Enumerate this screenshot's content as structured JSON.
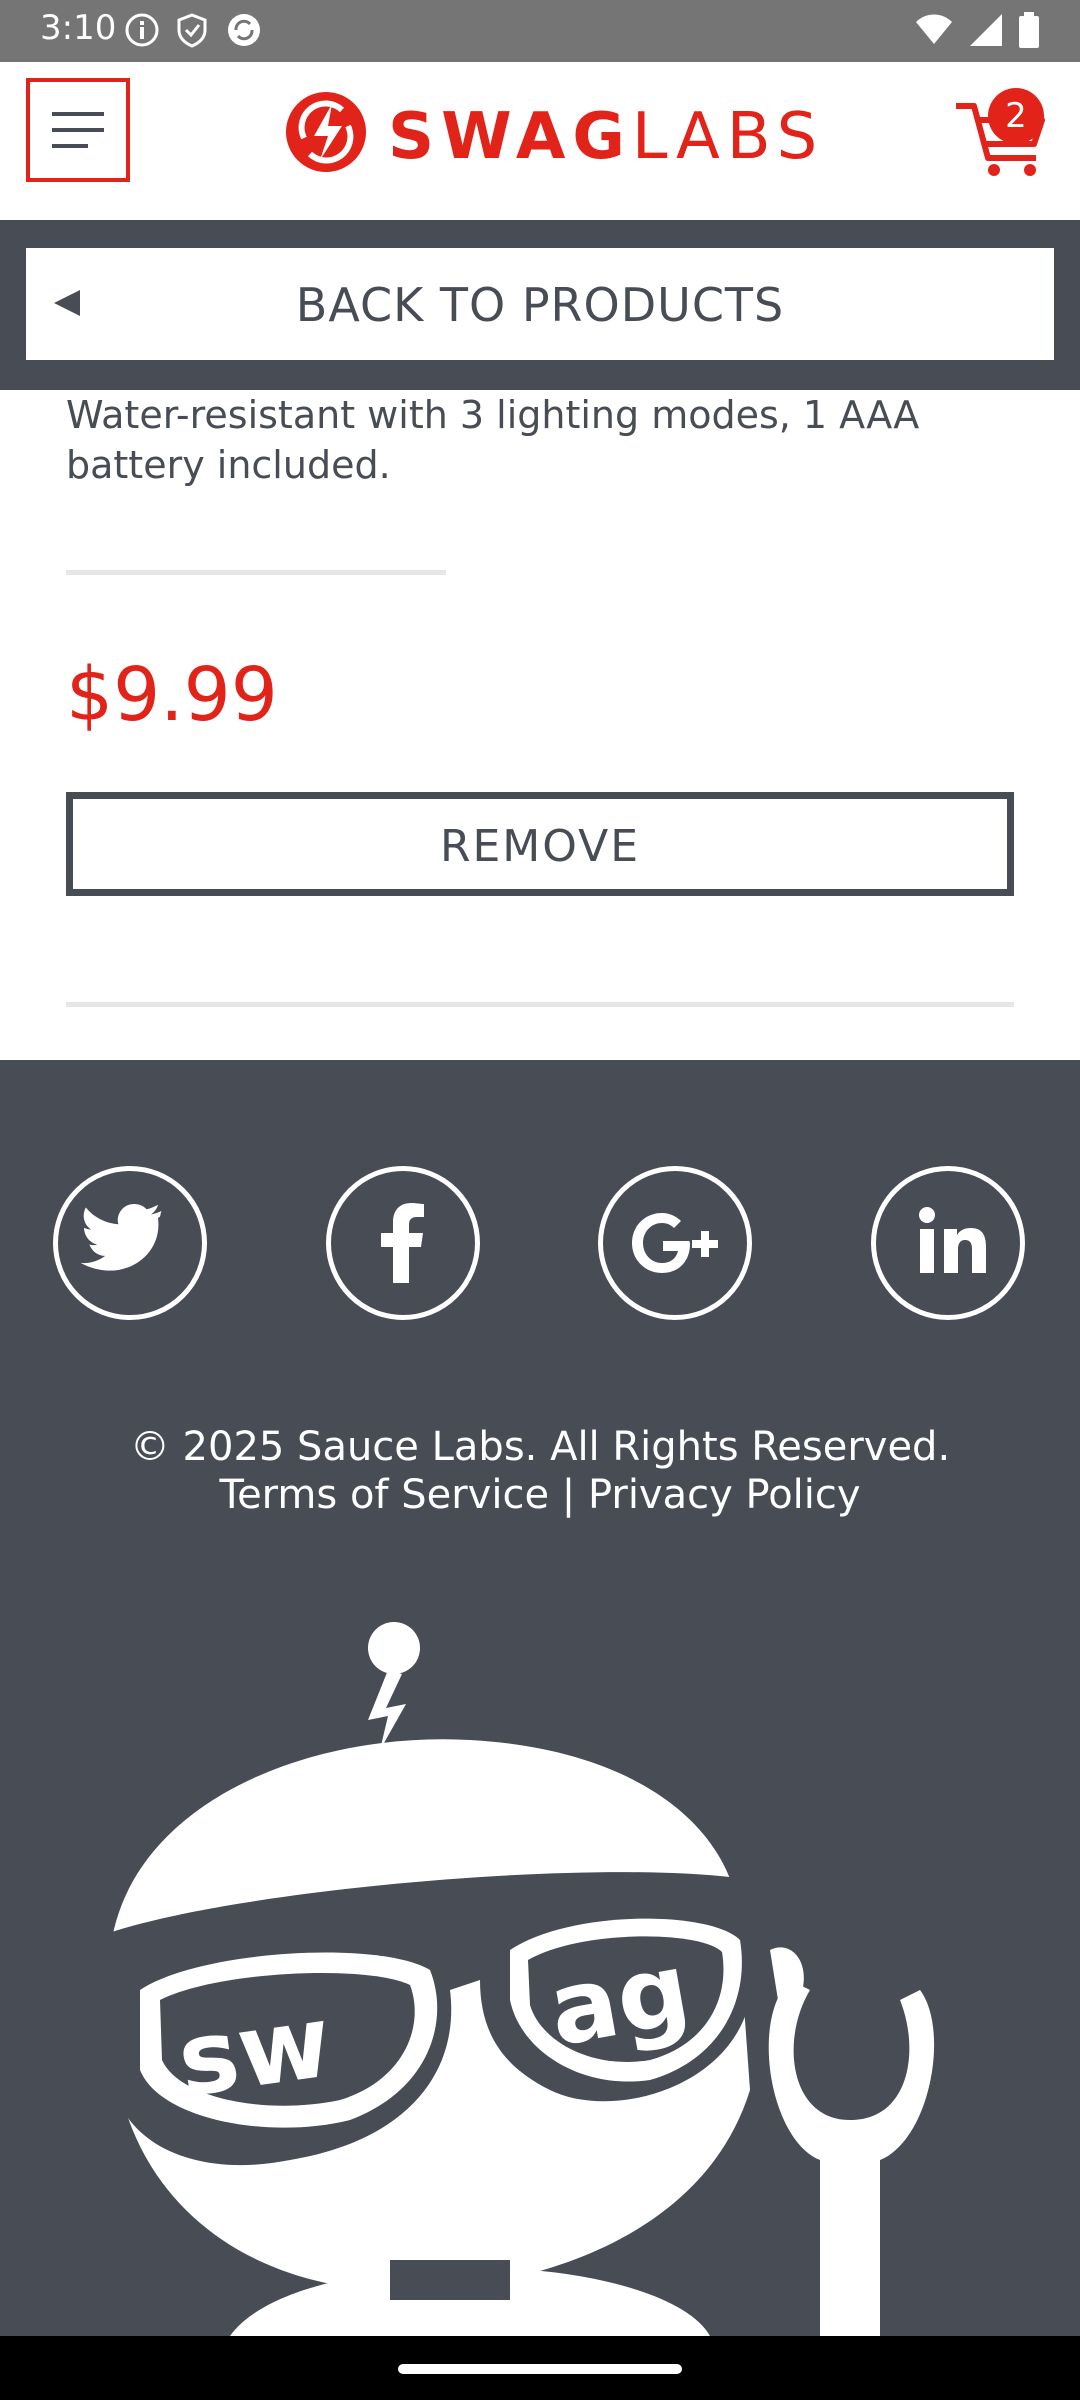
{
  "status_bar": {
    "time": "3:10"
  },
  "header": {
    "logo_bold": "SWAG",
    "logo_light": "LABS",
    "cart_count": "2"
  },
  "back": {
    "label": "BACK TO PRODUCTS"
  },
  "product": {
    "description": "Water-resistant with 3 lighting modes, 1 AAA battery included.",
    "price": "$9.99",
    "remove_label": "REMOVE"
  },
  "footer": {
    "social": [
      "twitter-icon",
      "facebook-icon",
      "google-plus-icon",
      "linkedin-icon"
    ],
    "copyright": "© 2025 Sauce Labs. All Rights Reserved.",
    "terms": "Terms of Service",
    "separator": " | ",
    "privacy": "Privacy Policy",
    "mascot_text_left": "sw",
    "mascot_text_right": "ag"
  },
  "colors": {
    "accent": "#e2231a",
    "dark": "#474c55",
    "status_bar": "#757575",
    "nav_bar": "#000000"
  }
}
